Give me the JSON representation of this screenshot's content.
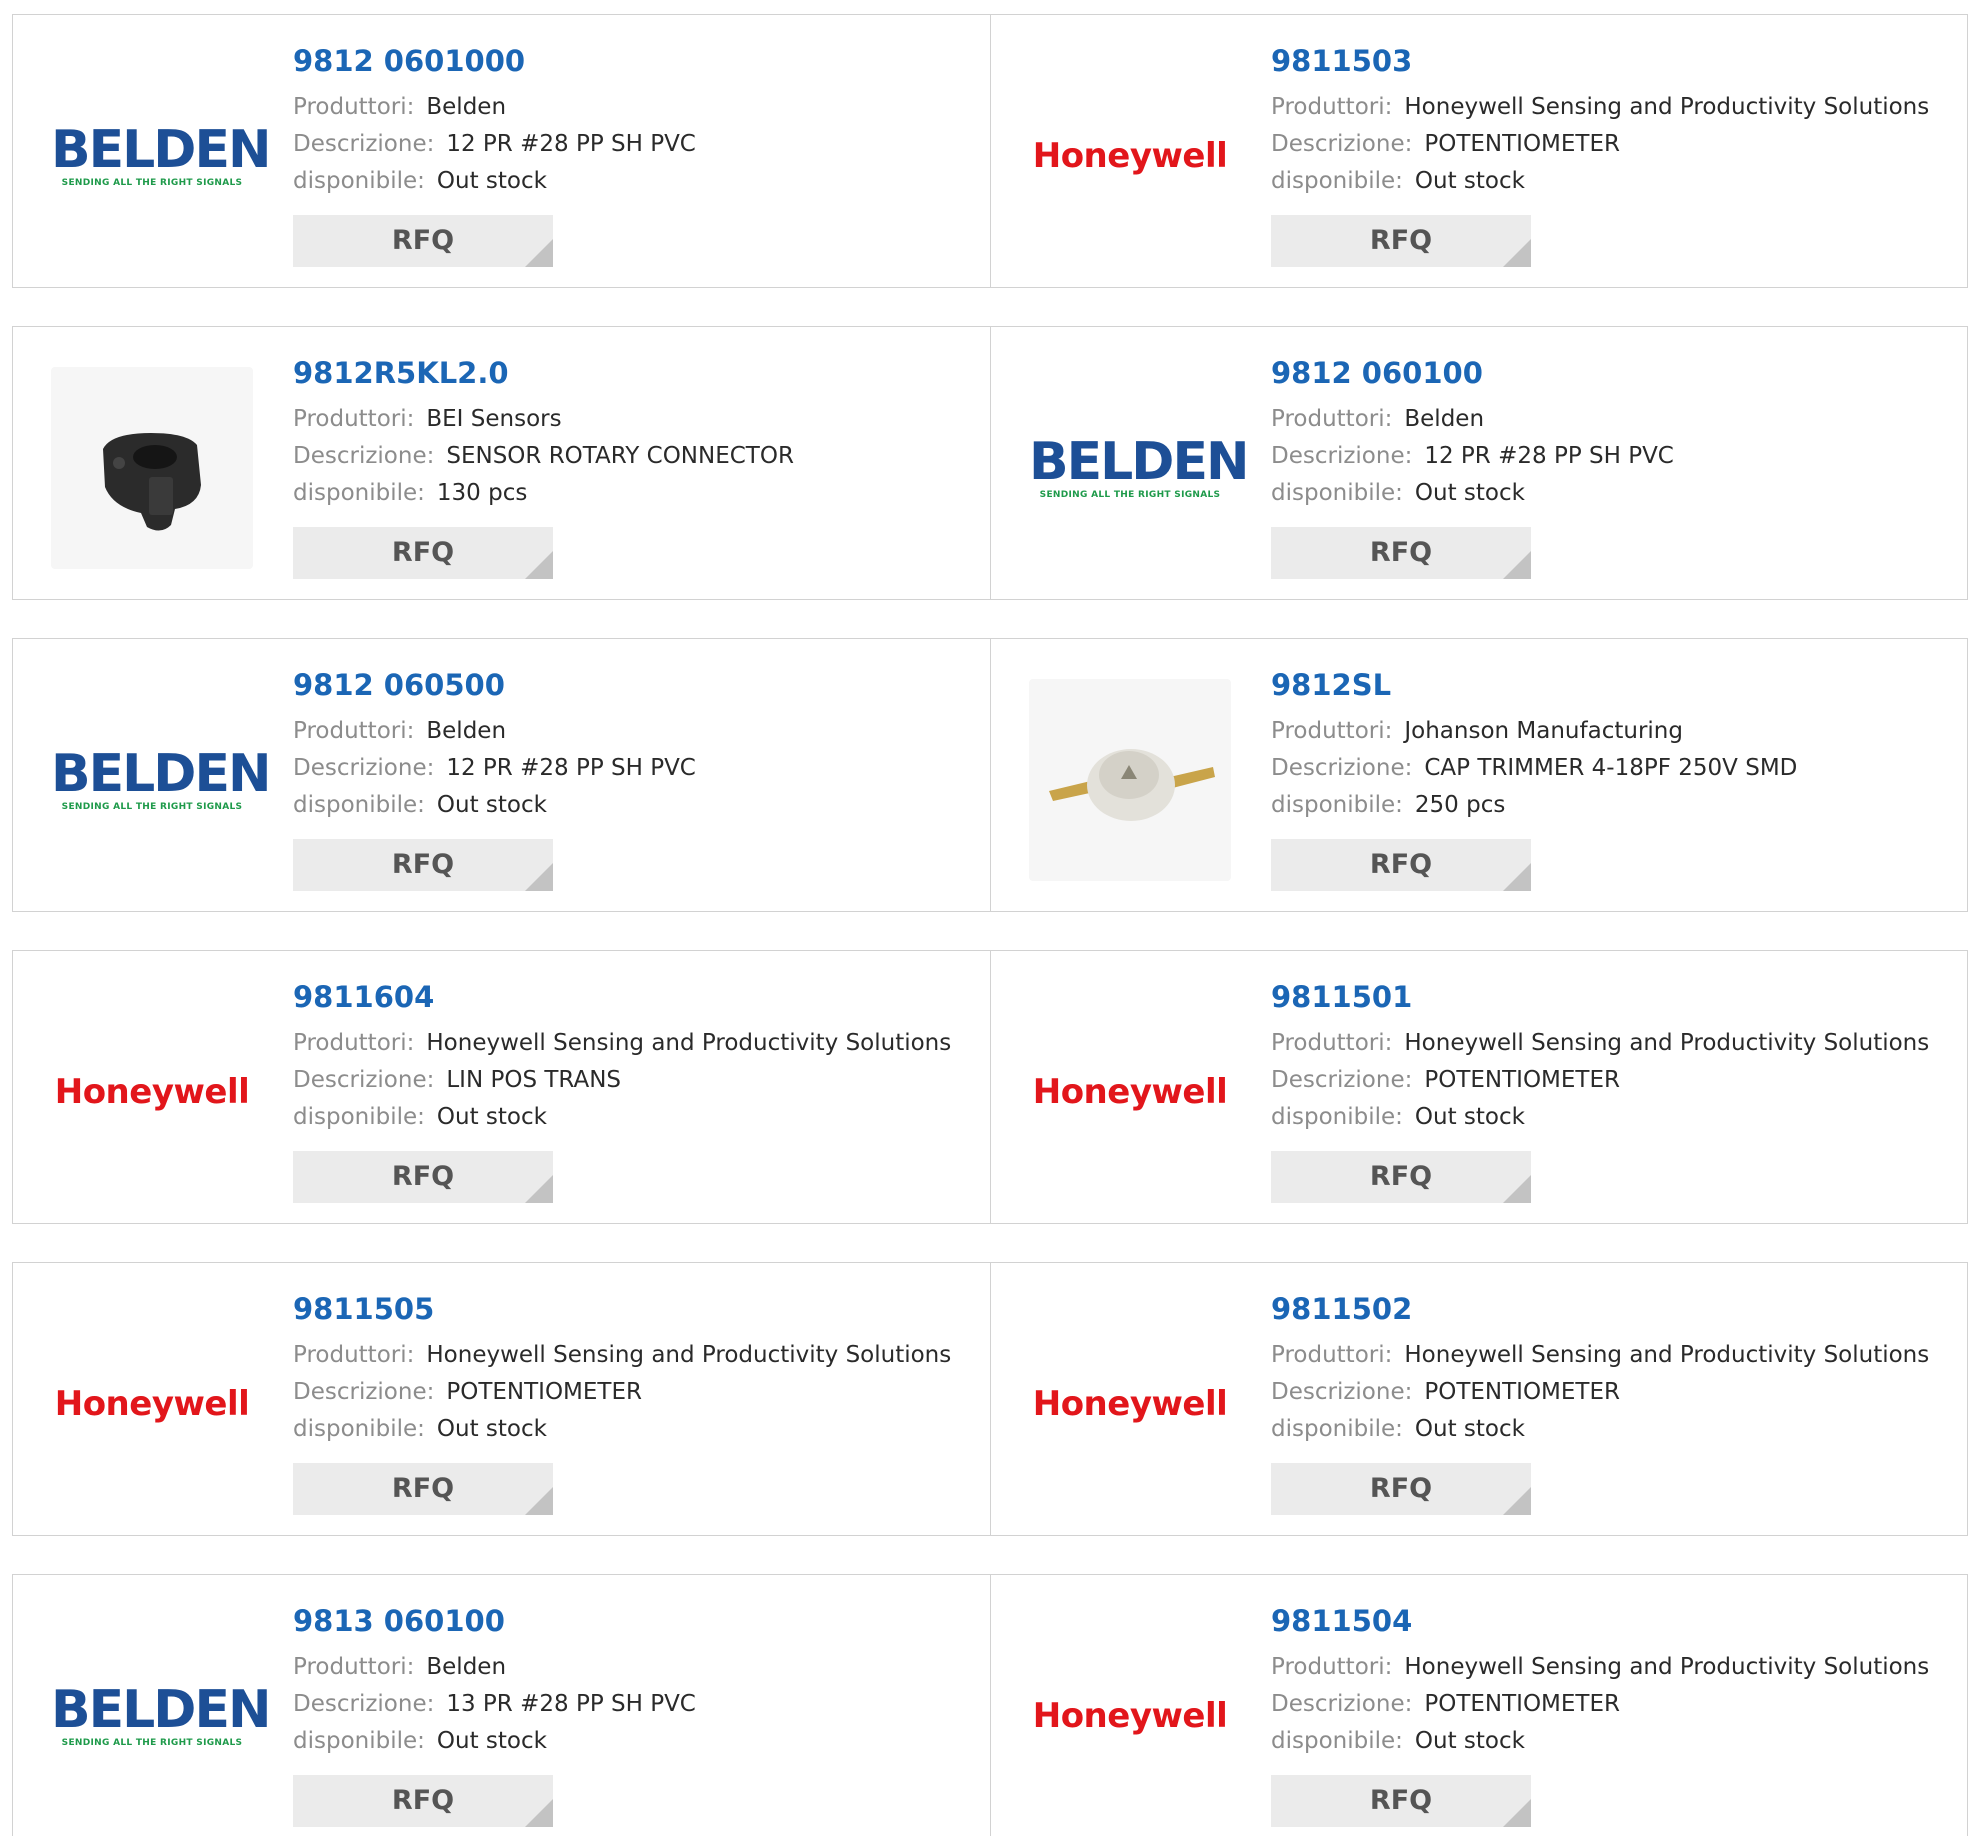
{
  "labels": {
    "producer": "Produttori:",
    "description": "Descrizione:",
    "availability": "disponibile:",
    "rfq": "RFQ"
  },
  "brand_logos": {
    "belden": {
      "word": "BELDEN",
      "tagline": "SENDING ALL THE RIGHT SIGNALS",
      "color": "#1d4f96",
      "tag_color": "#1e9a4a"
    },
    "honeywell": {
      "word": "Honeywell",
      "color": "#e2161b"
    }
  },
  "colors": {
    "part_link": "#1b66b5",
    "label": "#8c8c8c",
    "button_bg": "#ebebeb"
  },
  "products": [
    {
      "part": "9812 0601000",
      "producer": "Belden",
      "description": "12 PR #28 PP SH PVC",
      "availability": "Out stock",
      "image": "belden-logo"
    },
    {
      "part": "9811503",
      "producer": "Honeywell Sensing and Productivity Solutions",
      "description": "POTENTIOMETER",
      "availability": "Out stock",
      "image": "honeywell-logo"
    },
    {
      "part": "9812R5KL2.0",
      "producer": "BEI Sensors",
      "description": "SENSOR ROTARY CONNECTOR",
      "availability": "130 pcs",
      "image": "rotary-sensor-photo"
    },
    {
      "part": "9812 060100",
      "producer": "Belden",
      "description": "12 PR #28 PP SH PVC",
      "availability": "Out stock",
      "image": "belden-logo"
    },
    {
      "part": "9812 060500",
      "producer": "Belden",
      "description": "12 PR #28 PP SH PVC",
      "availability": "Out stock",
      "image": "belden-logo"
    },
    {
      "part": "9812SL",
      "producer": "Johanson Manufacturing",
      "description": "CAP TRIMMER 4-18PF 250V SMD",
      "availability": "250 pcs",
      "image": "trimmer-capacitor-photo"
    },
    {
      "part": "9811604",
      "producer": "Honeywell Sensing and Productivity Solutions",
      "description": "LIN POS TRANS",
      "availability": "Out stock",
      "image": "honeywell-logo"
    },
    {
      "part": "9811501",
      "producer": "Honeywell Sensing and Productivity Solutions",
      "description": "POTENTIOMETER",
      "availability": "Out stock",
      "image": "honeywell-logo"
    },
    {
      "part": "9811505",
      "producer": "Honeywell Sensing and Productivity Solutions",
      "description": "POTENTIOMETER",
      "availability": "Out stock",
      "image": "honeywell-logo"
    },
    {
      "part": "9811502",
      "producer": "Honeywell Sensing and Productivity Solutions",
      "description": "POTENTIOMETER",
      "availability": "Out stock",
      "image": "honeywell-logo"
    },
    {
      "part": "9813 060100",
      "producer": "Belden",
      "description": "13 PR #28 PP SH PVC",
      "availability": "Out stock",
      "image": "belden-logo"
    },
    {
      "part": "9811504",
      "producer": "Honeywell Sensing and Productivity Solutions",
      "description": "POTENTIOMETER",
      "availability": "Out stock",
      "image": "honeywell-logo"
    }
  ]
}
